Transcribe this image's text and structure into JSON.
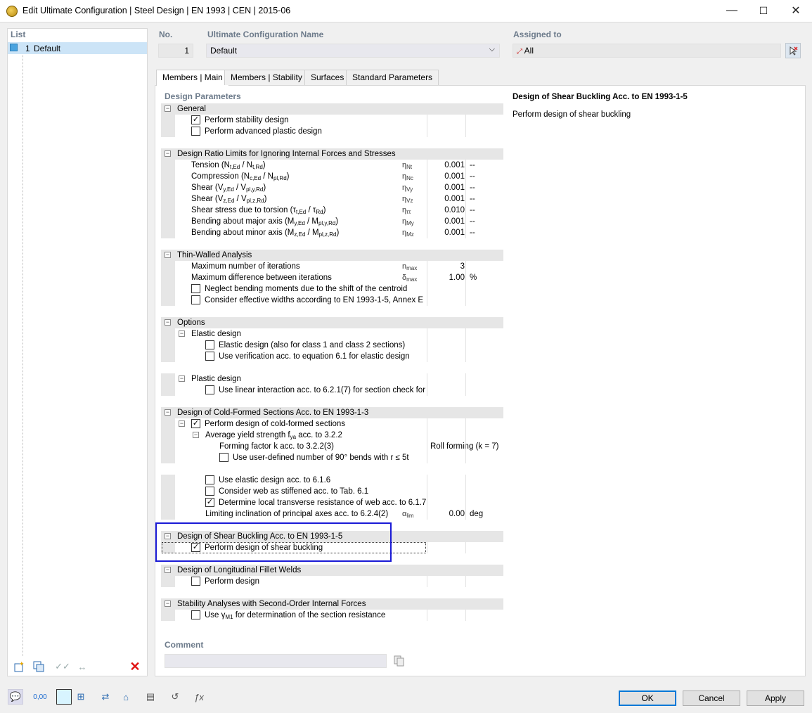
{
  "window": {
    "title": "Edit Ultimate Configuration | Steel Design | EN 1993 | CEN | 2015-06",
    "min": "—",
    "max": "☐",
    "close": "✕"
  },
  "list": {
    "header": "List",
    "items": [
      {
        "no": "1",
        "label": "Default"
      }
    ]
  },
  "config": {
    "no_header": "No.",
    "no_value": "1",
    "name_header": "Ultimate Configuration Name",
    "name_value": "Default",
    "assigned_header": "Assigned to",
    "assigned_value": "All"
  },
  "tabs": [
    "Members | Main",
    "Members | Stability",
    "Surfaces",
    "Standard Parameters"
  ],
  "design_params_header": "Design Parameters",
  "tree": {
    "general": {
      "title": "General",
      "items": [
        "Perform stability design",
        "Perform advanced plastic design"
      ]
    },
    "ratio": {
      "title": "Design Ratio Limits for Ignoring Internal Forces and Stresses",
      "rows": [
        {
          "label": "Tension (N",
          "s1": "t,Ed",
          "m": " / N",
          "s2": "t,Rd",
          "e": ")",
          "sym": "η",
          "symsub": "Nt",
          "value": "0.001",
          "unit": "--"
        },
        {
          "label": "Compression (N",
          "s1": "c,Ed",
          "m": " / N",
          "s2": "pl,Rd",
          "e": ")",
          "sym": "η",
          "symsub": "Nc",
          "value": "0.001",
          "unit": "--"
        },
        {
          "label": "Shear (V",
          "s1": "y,Ed",
          "m": " / V",
          "s2": "pl,y,Rd",
          "e": ")",
          "sym": "η",
          "symsub": "Vy",
          "value": "0.001",
          "unit": "--"
        },
        {
          "label": "Shear (V",
          "s1": "z,Ed",
          "m": " / V",
          "s2": "pl,z,Rd",
          "e": ")",
          "sym": "η",
          "symsub": "Vz",
          "value": "0.001",
          "unit": "--"
        },
        {
          "label": "Shear stress due to torsion (τ",
          "s1": "t,Ed",
          "m": " / τ",
          "s2": "Rd",
          "e": ")",
          "sym": "η",
          "symsub": "ττ",
          "value": "0.010",
          "unit": "--"
        },
        {
          "label": "Bending about major axis (M",
          "s1": "y,Ed",
          "m": " / M",
          "s2": "pl,y,Rd",
          "e": ")",
          "sym": "η",
          "symsub": "My",
          "value": "0.001",
          "unit": "--"
        },
        {
          "label": "Bending about minor axis (M",
          "s1": "z,Ed",
          "m": " / M",
          "s2": "pl,z,Rd",
          "e": ")",
          "sym": "η",
          "symsub": "Mz",
          "value": "0.001",
          "unit": "--"
        }
      ]
    },
    "thin": {
      "title": "Thin-Walled Analysis",
      "r1": "Maximum number of iterations",
      "r1sym": "n",
      "r1sub": "max",
      "r1val": "3",
      "r2": "Maximum difference between iterations",
      "r2sym": "δ",
      "r2sub": "max",
      "r2val": "1.00",
      "r2unit": "%",
      "c1": "Neglect bending moments due to the shift of the centroid",
      "c2": "Consider effective widths according to EN 1993-1-5, Annex E"
    },
    "options": {
      "title": "Options",
      "elastic": "Elastic design",
      "e1": "Elastic design (also for class 1 and class 2 sections)",
      "e2": "Use verification acc. to equation 6.1 for elastic design",
      "plastic": "Plastic design",
      "p1": "Use linear interaction acc. to 6.2.1(7) for section check for"
    },
    "cold": {
      "title": "Design of Cold-Formed Sections Acc. to EN 1993-1-3",
      "c1": "Perform design of cold-formed sections",
      "avg": "Average yield strength f",
      "avgsub": "ya",
      "avgend": " acc. to 3.2.2",
      "ff": "Forming factor k acc. to 3.2.2(3)",
      "ffval": "Roll forming (k = 7)",
      "ud": "Use user-defined number of 90° bends with r ≤ 5t",
      "c2": "Use elastic design acc. to 6.1.6",
      "c3": "Consider web as stiffened acc. to Tab. 6.1",
      "c4": "Determine local transverse resistance of web acc. to 6.1.7",
      "lim": "Limiting inclination of principal axes acc. to 6.2.4(2)",
      "limsym": "α",
      "limsub": "lim",
      "limval": "0.00",
      "limunit": "deg"
    },
    "shear": {
      "title": "Design of Shear Buckling Acc. to EN 1993-1-5",
      "c1": "Perform design of shear buckling"
    },
    "welds": {
      "title": "Design of Longitudinal Fillet Welds",
      "c1": "Perform design"
    },
    "stab": {
      "title": "Stability Analyses with Second-Order Internal Forces",
      "c1": "Use γ",
      "c1sub": "M1",
      "c1end": " for determination of the section resistance"
    }
  },
  "description": {
    "title": "Design of Shear Buckling Acc. to EN 1993-1-5",
    "text": "Perform design of shear buckling"
  },
  "comment": {
    "header": "Comment",
    "value": ""
  },
  "buttons": {
    "ok": "OK",
    "cancel": "Cancel",
    "apply": "Apply"
  },
  "colors": {
    "highlight": "#1a1ad6",
    "selection": "#cce4f7",
    "header": "#6d7b8b"
  }
}
